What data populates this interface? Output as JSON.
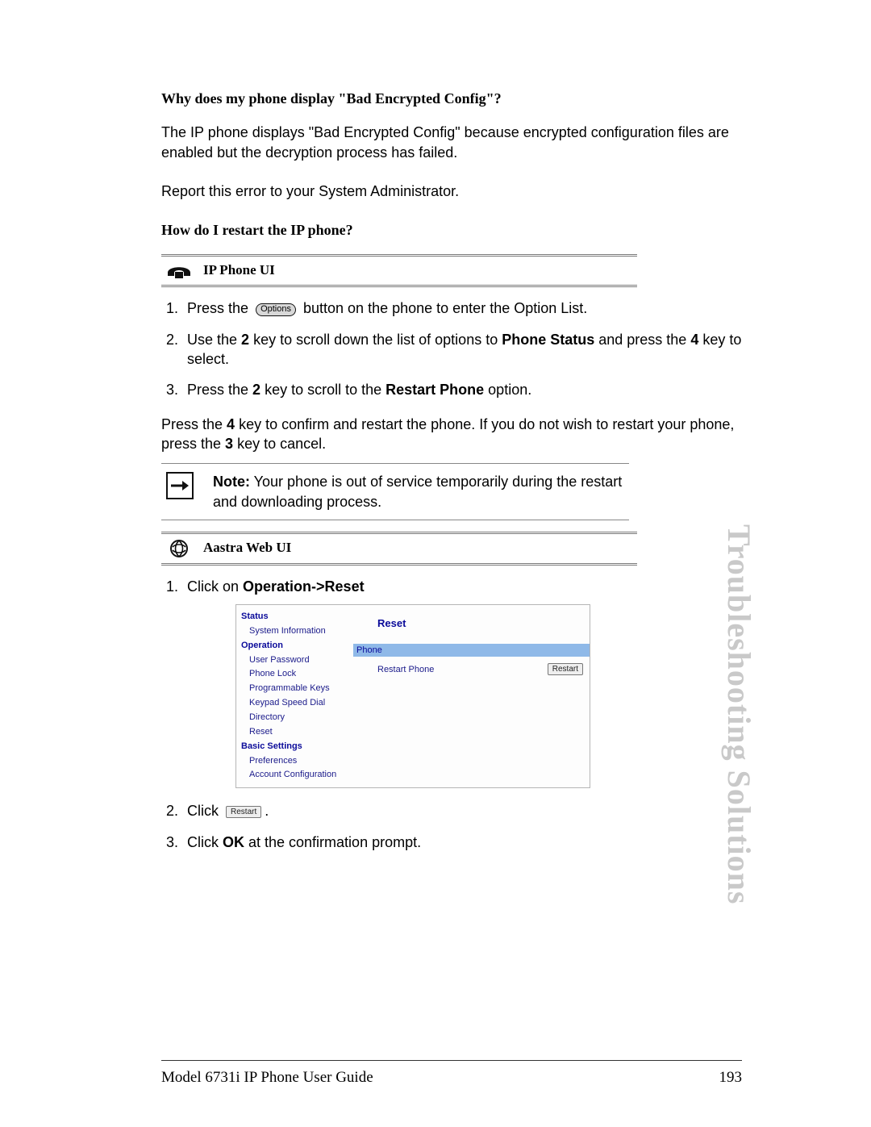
{
  "section1": {
    "title": "Why does my phone display \"Bad Encrypted Config\"?",
    "para1": "The IP phone displays \"Bad Encrypted Config\" because encrypted configuration files are enabled but the decryption process has failed.",
    "para2": "Report this error to your System Administrator."
  },
  "section2": {
    "title": "How do I restart the IP phone?"
  },
  "ipPhoneHeader": "IP Phone UI",
  "optionsLabel": "Options",
  "steps1": {
    "s1a": "Press the",
    "s1b": "button on the phone to enter the Option List.",
    "s2a": "Use the ",
    "s2key1": "2",
    "s2b": " key to scroll down the list of options to ",
    "s2bold": "Phone Status",
    "s2c": " and press the ",
    "s2key2": "4",
    "s2d": " key to select.",
    "s3a": "Press the ",
    "s3key": "2",
    "s3b": " key to scroll to the ",
    "s3bold": "Restart Phone",
    "s3c": " option."
  },
  "confirm": {
    "a": "Press the ",
    "key1": "4",
    "b": " key to confirm and restart the phone. If you do not wish to restart your phone, press the ",
    "key2": "3",
    "c": " key to cancel."
  },
  "note": {
    "label": "Note:",
    "text": " Your phone is out of service temporarily during the restart and downloading process."
  },
  "webHeader": "Aastra Web UI",
  "webStep1a": "Click on ",
  "webStep1b": "Operation->Reset",
  "webui": {
    "status": "Status",
    "sysinfo": "System Information",
    "operation": "Operation",
    "userpw": "User Password",
    "plock": "Phone Lock",
    "pkeys": "Programmable Keys",
    "ksd": "Keypad Speed Dial",
    "dir": "Directory",
    "reset": "Reset",
    "basic": "Basic Settings",
    "prefs": "Preferences",
    "acct": "Account Configuration",
    "mainTitle": "Reset",
    "barPhone": "Phone",
    "restartPhone": "Restart Phone",
    "restartBtn": "Restart"
  },
  "webStep2a": "Click",
  "webStep2btn": "Restart",
  "webStep2b": ".",
  "webStep3a": "Click ",
  "webStep3b": "OK",
  "webStep3c": " at the confirmation prompt.",
  "sideTitle": "Troubleshooting Solutions",
  "footer": {
    "left": "Model 6731i IP Phone User Guide",
    "right": "193"
  }
}
